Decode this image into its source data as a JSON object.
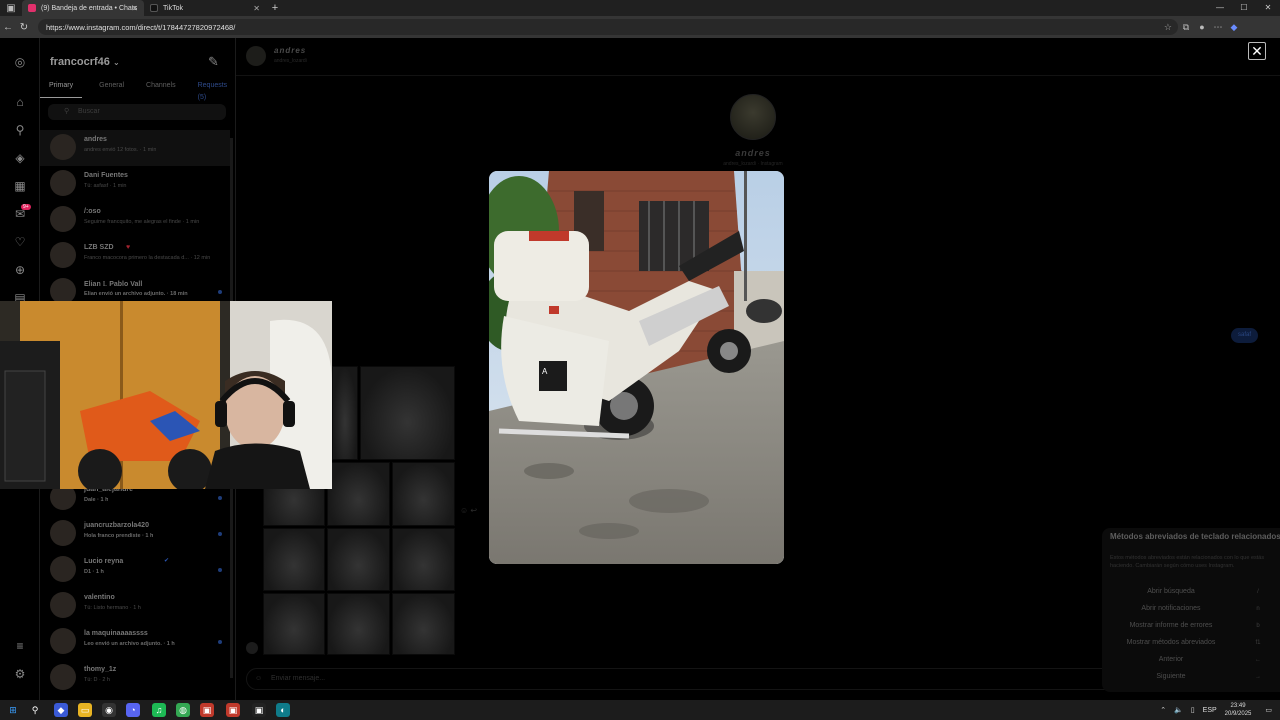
{
  "browser": {
    "tabs": [
      {
        "title": "(9) Bandeja de entrada • Chats",
        "color": "#e1306c"
      },
      {
        "title": "TikTok",
        "color": "#111111"
      }
    ],
    "url": "https://www.instagram.com/direct/t/17844727820972468/"
  },
  "inbox": {
    "username": "francocrf46",
    "tabs": [
      "Primary",
      "General",
      "Channels",
      "Requests (5)"
    ],
    "search_placeholder": "Buscar",
    "notification_badge": "9+",
    "chats": [
      {
        "name": "andres",
        "preview": "andres envió 12 fotos. · 1 min",
        "selected": true
      },
      {
        "name": "Dani Fuentes",
        "preview": "Tú: asfasf · 1 min"
      },
      {
        "name": "/:oso",
        "preview": "Seguime francquito, me alegras el finde · 1 min"
      },
      {
        "name": "LZB SZD",
        "preview": "Franco macocora primero la destacada d... · 12 min",
        "heart": true
      },
      {
        "name": "Elian 𝕃 Pablo Vall",
        "preview": "Elian envió un archivo adjunto. · 18 min",
        "unread": true
      },
      {
        "name": "juan_alejandre",
        "preview": "Dale · 1 h",
        "unread": true
      },
      {
        "name": "juancruzbarzola420",
        "preview": "Hola franco prendiste · 1 h",
        "unread": true
      },
      {
        "name": "Lucio reyna",
        "preview": "D1 · 1 h",
        "unread": true,
        "verified": true
      },
      {
        "name": "valentino",
        "preview": "Tú: Listo hermano · 1 h"
      },
      {
        "name": "la maquinaaaassss",
        "preview": "Leo envió un archivo adjunto. · 1 h",
        "unread": true
      },
      {
        "name": "thomy_1z",
        "preview": "Tú: D · 2 h"
      }
    ]
  },
  "conversation": {
    "name": "andres",
    "handle": "andres_lozardi",
    "profile_name": "andres",
    "profile_sub": "andres_lozardi · Instagram",
    "bubble": "safaf",
    "input_placeholder": "Enviar mensaje..."
  },
  "shortcuts": {
    "title": "Métodos abreviados de teclado relacionados",
    "description": "Estos métodos abreviados están relacionados con lo que estás haciendo. Cambiarán según cómo uses Instagram.",
    "items": [
      {
        "label": "Abrir búsqueda",
        "key": "/"
      },
      {
        "label": "Abrir notificaciones",
        "key": "n"
      },
      {
        "label": "Mostrar informe de errores",
        "key": "b"
      },
      {
        "label": "Mostrar métodos abreviados",
        "key": "f1"
      },
      {
        "label": "Anterior",
        "key": "←"
      },
      {
        "label": "Siguiente",
        "key": "→"
      }
    ]
  },
  "taskbar": {
    "tray_lang": "ESP",
    "time": "23:49",
    "date": "20/9/2025"
  }
}
